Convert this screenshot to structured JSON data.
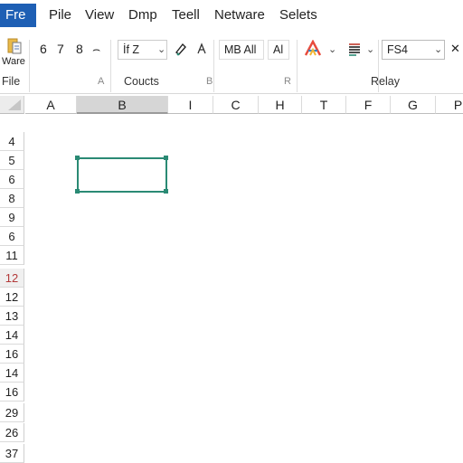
{
  "menu": {
    "items": [
      "Fre",
      "Pile",
      "View",
      "Dmp",
      "Teell",
      "Netware",
      "Selets"
    ]
  },
  "ribbon": {
    "paste_label": "Ware",
    "tools_group1": [
      "6",
      "7",
      "8",
      "⌢"
    ],
    "font_box": "İf  Z",
    "mb_box": "MB  All",
    "al_box": "Al",
    "fs_box": "FS4",
    "group_labels": {
      "file": "File",
      "a": "A",
      "counts": "Coucts",
      "b": "B",
      "r": "R",
      "relay": "Relay"
    }
  },
  "sheet": {
    "columns": [
      "A",
      "B",
      "I",
      "C",
      "H",
      "T",
      "F",
      "G",
      "P"
    ],
    "selected_column": "B",
    "rows": [
      "4",
      "5",
      "6",
      "8",
      "9",
      "6",
      "11",
      "12",
      "12",
      "13",
      "14",
      "16",
      "14",
      "16",
      "29",
      "26",
      "37"
    ],
    "selected_row": "12"
  },
  "colors": {
    "menu_accent": "#1e5fb4",
    "selection": "#2a8a74",
    "selected_row_text": "#b33a3a"
  }
}
